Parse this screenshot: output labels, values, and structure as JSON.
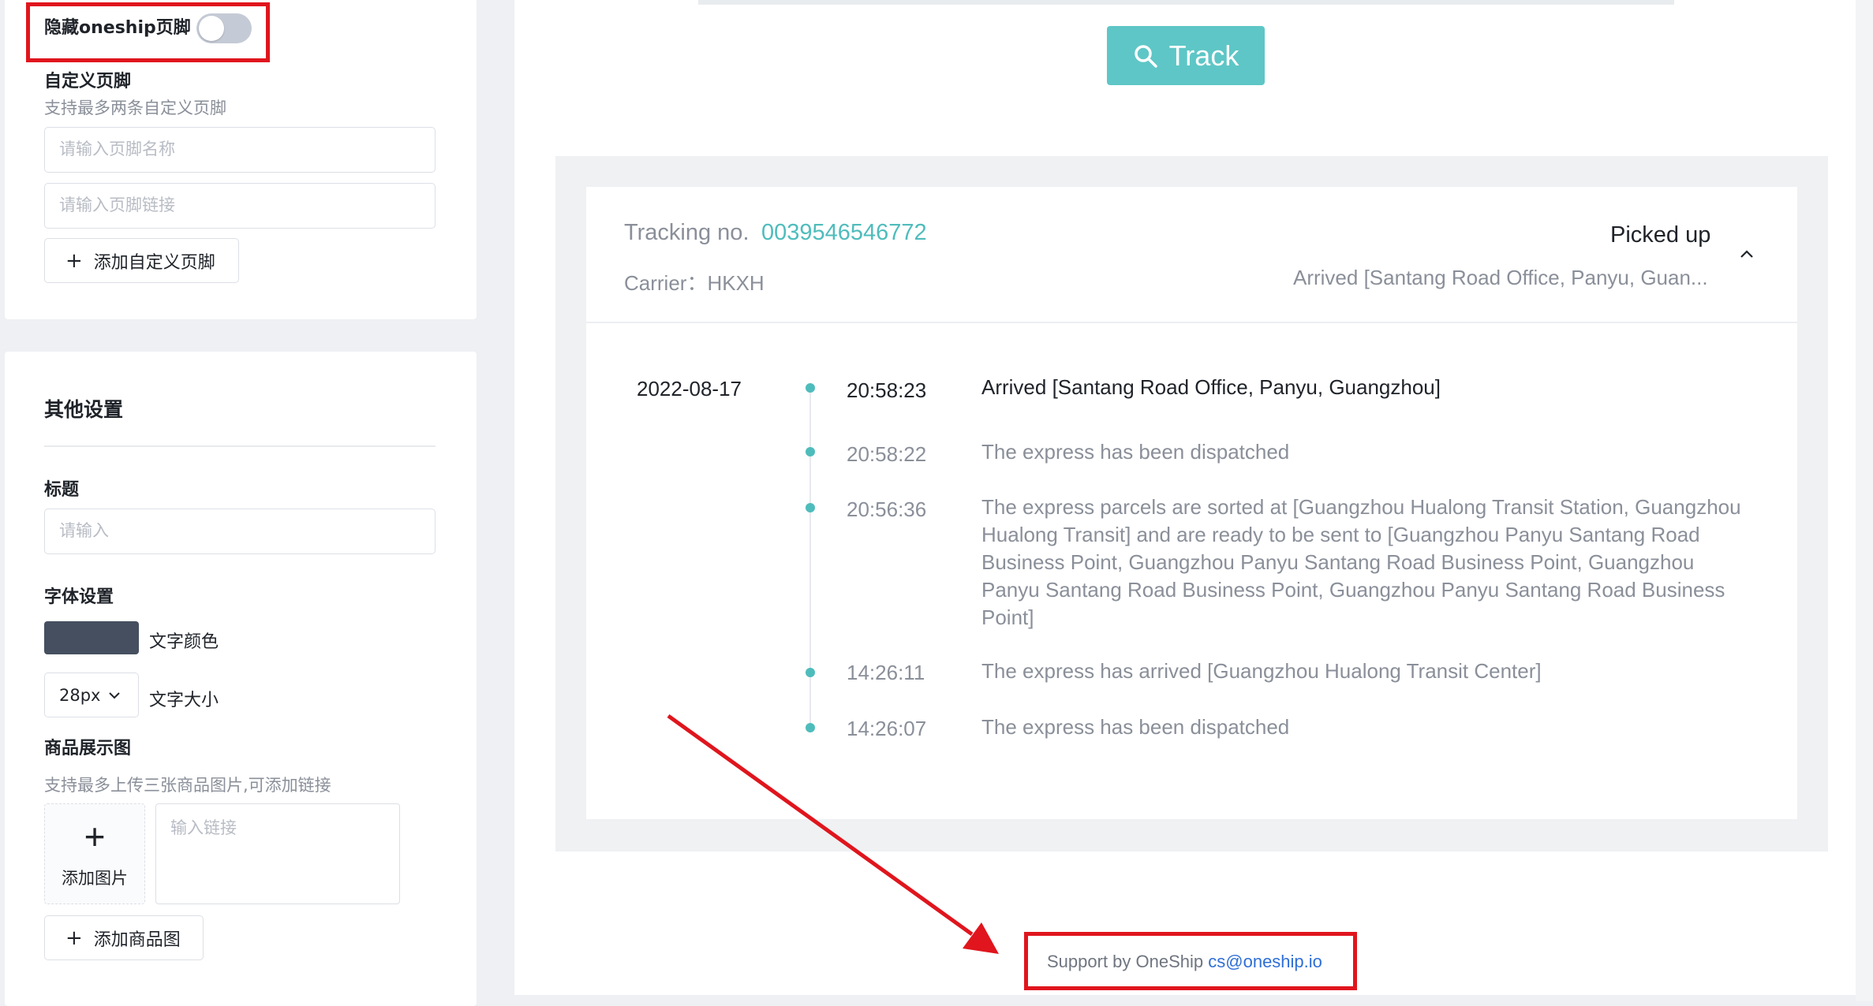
{
  "footer_settings": {
    "hide_footer_label": "隐藏oneship页脚",
    "hide_footer_on": false,
    "custom_footer_title": "自定义页脚",
    "custom_footer_hint": "支持最多两条自定义页脚",
    "name_placeholder": "请输入页脚名称",
    "link_placeholder": "请输入页脚链接",
    "add_footer_label": "添加自定义页脚"
  },
  "other_settings": {
    "section_title": "其他设置",
    "title_label": "标题",
    "title_placeholder": "请输入",
    "font_label": "字体设置",
    "text_color": "#454f5f",
    "text_color_label": "文字颜色",
    "font_size": "28px",
    "font_size_label": "文字大小",
    "product_label": "商品展示图",
    "product_hint": "支持最多上传三张商品图片,可添加链接",
    "add_image_label": "添加图片",
    "link_placeholder": "输入链接",
    "add_product_label": "添加商品图"
  },
  "preview": {
    "track_button": "Track",
    "tracking_label": "Tracking no.",
    "tracking_number": "0039546546772",
    "carrier_label": "Carrier：HKXH",
    "status": "Picked up",
    "latest_summary": "Arrived [Santang Road Office, Panyu, Guan...",
    "date": "2022-08-17",
    "events": [
      {
        "time": "20:58:23",
        "desc": "Arrived [Santang Road Office, Panyu, Guangzhou]"
      },
      {
        "time": "20:58:22",
        "desc": "The express has been dispatched"
      },
      {
        "time": "20:56:36",
        "desc": "The express parcels are sorted at [Guangzhou Hualong Transit Station, Guangzhou Hualong Transit] and are ready to be sent to [Guangzhou Panyu Santang Road Business Point, Guangzhou Panyu Santang Road Business Point, Guangzhou Panyu Santang Road Business Point, Guangzhou Panyu Santang Road Business Point]"
      },
      {
        "time": "14:26:11",
        "desc": "The express has arrived [Guangzhou Hualong Transit Center]"
      },
      {
        "time": "14:26:07",
        "desc": "The express has been dispatched"
      }
    ],
    "support_text": "Support by OneShip",
    "support_email": "cs@oneship.io"
  },
  "colors": {
    "accent": "#5ec6c6",
    "highlight": "#e0151d"
  }
}
